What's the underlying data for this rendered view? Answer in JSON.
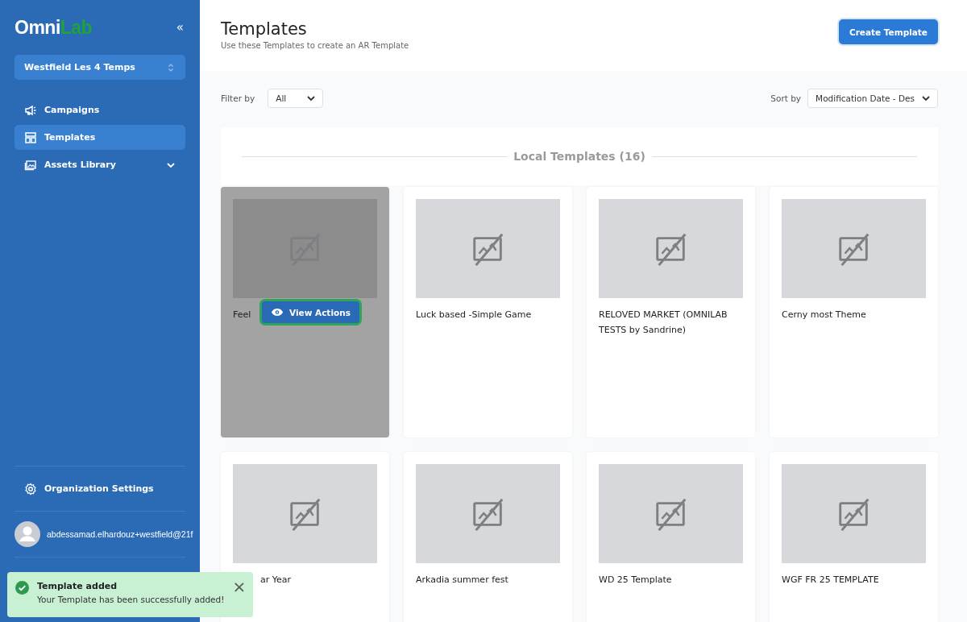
{
  "sidebar": {
    "logo": {
      "part_1": "Omni",
      "part_2": "Lab"
    },
    "collapse": "«",
    "organization": "Westfield Les 4 Temps",
    "items": [
      {
        "label": "Campaigns",
        "selected": false,
        "expandable": false
      },
      {
        "label": "Templates",
        "selected": true,
        "expandable": false
      },
      {
        "label": "Assets Library",
        "selected": false,
        "expandable": true
      }
    ],
    "settings": "Organization Settings",
    "user": "abdessamad.elhardouz+westfield@21f"
  },
  "header": {
    "title": "Templates",
    "subtitle": "Use these Templates to create an AR Template",
    "create_button": "Create Template"
  },
  "filters": {
    "filter_label": "Filter by",
    "filter_value": "All",
    "sort_label": "Sort by",
    "sort_value": "Modification Date - Des"
  },
  "section": {
    "title": "Local Templates (16)"
  },
  "cards": [
    {
      "title": "Feel",
      "hovered": true,
      "action": "View Actions"
    },
    {
      "title": "Luck based -Simple Game",
      "hovered": false
    },
    {
      "title": "RELOVED MARKET (OMNILAB TESTS by Sandrine)",
      "hovered": false
    },
    {
      "title": "Cerny most Theme",
      "hovered": false
    },
    {
      "title": "ar Year",
      "hovered": false,
      "partly_covered": true
    },
    {
      "title": "Arkadia summer fest",
      "hovered": false
    },
    {
      "title": "WD 25 Template",
      "hovered": false
    },
    {
      "title": "WGF FR 25 TEMPLATE",
      "hovered": false
    }
  ],
  "toast": {
    "title": "Template added",
    "message": "Your Template has been successfully added!",
    "close": "×"
  }
}
